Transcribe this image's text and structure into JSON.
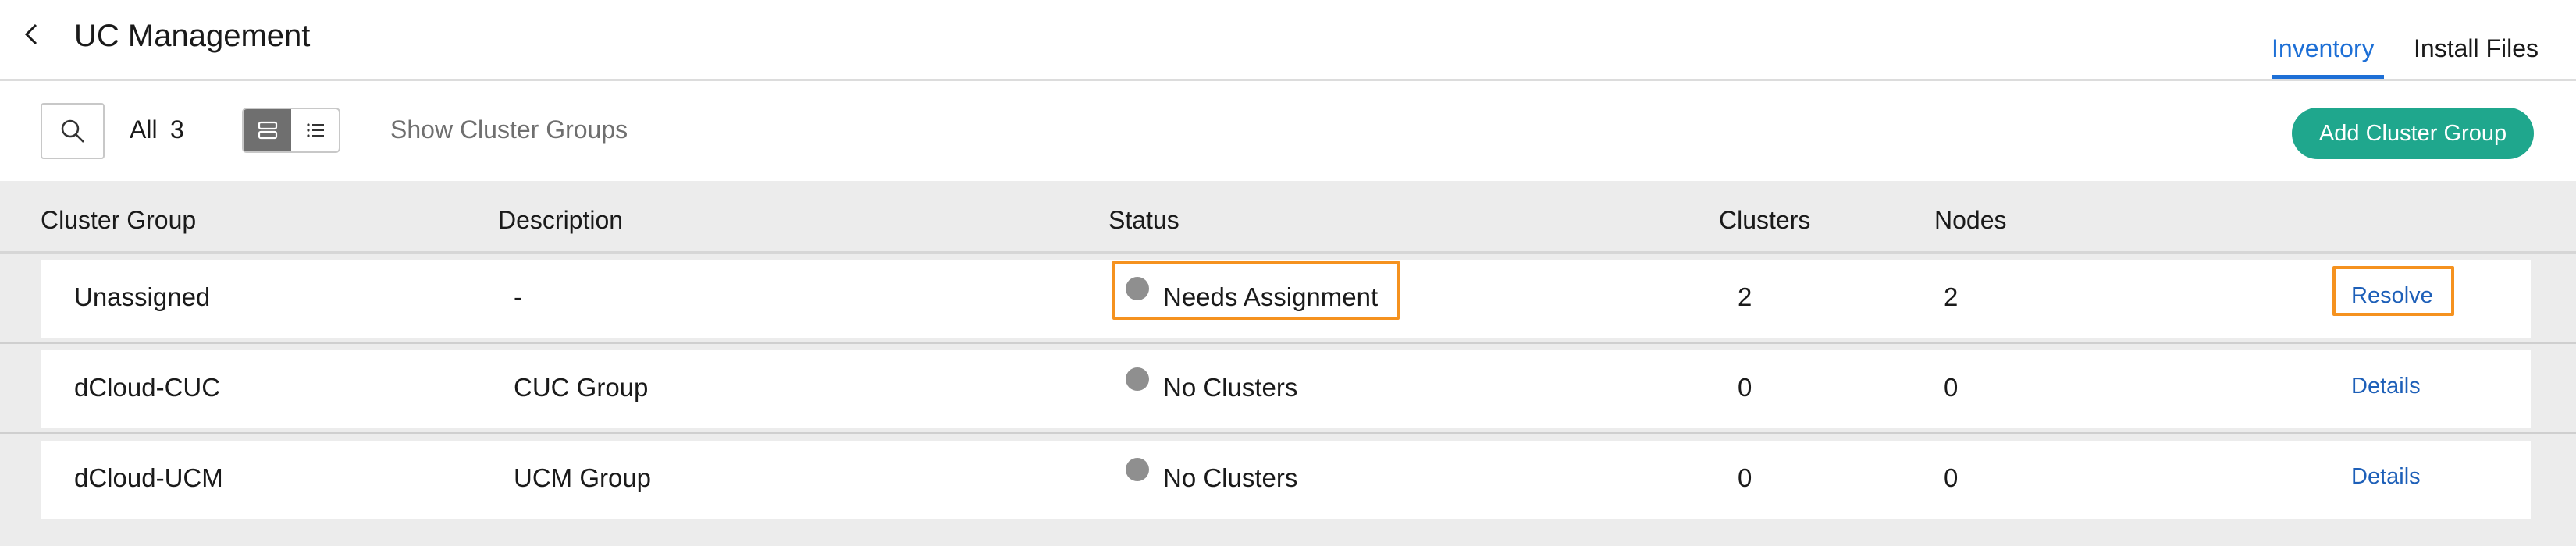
{
  "header": {
    "title": "UC Management",
    "tabs": [
      {
        "label": "Inventory",
        "active": true
      },
      {
        "label": "Install Files",
        "active": false
      }
    ]
  },
  "toolbar": {
    "filter_label": "All",
    "filter_count": "3",
    "show_groups_label": "Show Cluster Groups",
    "add_button_label": "Add Cluster Group"
  },
  "table": {
    "columns": [
      "Cluster Group",
      "Description",
      "Status",
      "Clusters",
      "Nodes"
    ],
    "rows": [
      {
        "cluster_group": "Unassigned",
        "description": "-",
        "status": "Needs Assignment",
        "clusters": "2",
        "nodes": "2",
        "action": "Resolve",
        "highlighted": true
      },
      {
        "cluster_group": "dCloud-CUC",
        "description": "CUC Group",
        "status": "No Clusters",
        "clusters": "0",
        "nodes": "0",
        "action": "Details",
        "highlighted": false
      },
      {
        "cluster_group": "dCloud-UCM",
        "description": "UCM Group",
        "status": "No Clusters",
        "clusters": "0",
        "nodes": "0",
        "action": "Details",
        "highlighted": false
      }
    ]
  },
  "colors": {
    "accent_blue": "#1d6fd6",
    "add_button": "#1fa78d",
    "highlight": "#f5921f",
    "status_dot": "#8f8f8f"
  },
  "icons": [
    "chevron-left-icon",
    "search-icon",
    "card-view-icon",
    "list-view-icon",
    "status-dot-icon"
  ]
}
